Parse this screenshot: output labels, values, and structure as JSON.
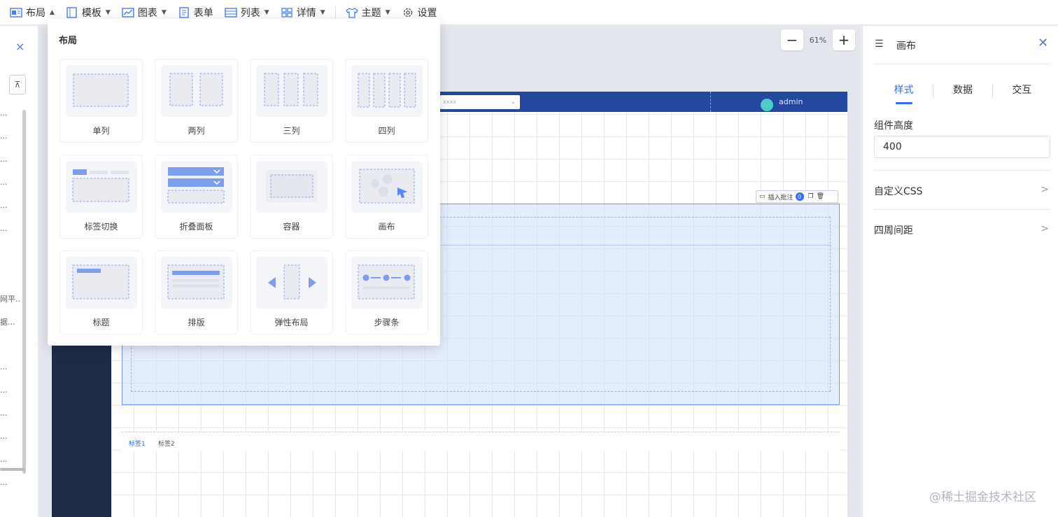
{
  "toolbar": {
    "items": [
      {
        "label": "布局",
        "icon": "layout-icon",
        "caret": "▲"
      },
      {
        "label": "模板",
        "icon": "template-icon",
        "caret": "▼"
      },
      {
        "label": "图表",
        "icon": "chart-icon",
        "caret": "▼"
      },
      {
        "label": "表单",
        "icon": "form-icon",
        "caret": ""
      },
      {
        "label": "列表",
        "icon": "list-icon",
        "caret": "▼"
      },
      {
        "label": "详情",
        "icon": "detail-icon",
        "caret": "▼"
      },
      {
        "label": "主题",
        "icon": "theme-icon",
        "caret": "▼"
      },
      {
        "label": "设置",
        "icon": "gear-icon",
        "caret": ""
      }
    ]
  },
  "left_panel": {
    "close": "×",
    "filter": "⊼",
    "rows": [
      "...",
      "...",
      "...",
      "...",
      "...",
      "...",
      "",
      "",
      "网平...",
      "据...",
      "",
      "...",
      "...",
      "...",
      "...",
      "...",
      "..."
    ]
  },
  "zoom": {
    "minus": "−",
    "value": "61%",
    "plus": "+"
  },
  "canvas": {
    "header_select_placeholder": "xxxx",
    "user": "admin",
    "sel_toolbar_label": "插入批注",
    "sel_toolbar_badge": "0",
    "tabs": [
      "标签1",
      "标签2"
    ]
  },
  "right_panel": {
    "title": "画布",
    "tabs": [
      "样式",
      "数据",
      "交互"
    ],
    "height_label": "组件高度",
    "height_value": "400",
    "custom_css": "自定义CSS",
    "spacing": "四周间距",
    "arrow": ">"
  },
  "dropdown": {
    "title": "布局",
    "items": [
      {
        "label": "单列",
        "icon": "single-column-icon"
      },
      {
        "label": "两列",
        "icon": "two-column-icon"
      },
      {
        "label": "三列",
        "icon": "three-column-icon"
      },
      {
        "label": "四列",
        "icon": "four-column-icon"
      },
      {
        "label": "标签切换",
        "icon": "tab-switch-icon"
      },
      {
        "label": "折叠面板",
        "icon": "collapse-panel-icon"
      },
      {
        "label": "容器",
        "icon": "container-icon"
      },
      {
        "label": "画布",
        "icon": "canvas-icon"
      },
      {
        "label": "标题",
        "icon": "title-icon"
      },
      {
        "label": "排版",
        "icon": "typography-icon"
      },
      {
        "label": "弹性布局",
        "icon": "flex-layout-icon"
      },
      {
        "label": "步骤条",
        "icon": "steps-icon"
      }
    ]
  },
  "watermark": "@稀土掘金技术社区",
  "colors": {
    "accent": "#2f6df6",
    "header": "#2447a0",
    "sidebar": "#1e2a46"
  }
}
